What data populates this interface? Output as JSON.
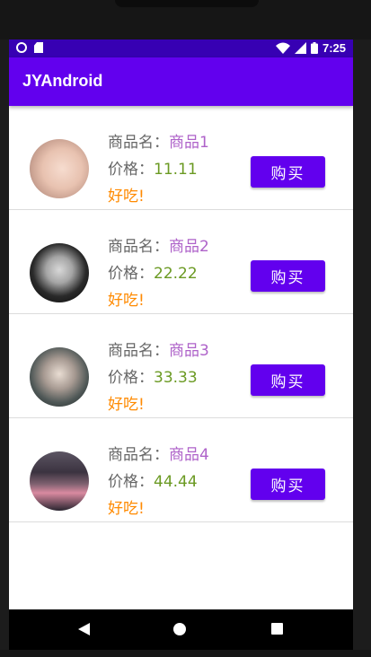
{
  "status_bar": {
    "time": "7:25",
    "left_icons": [
      "circle-indicator-icon",
      "sd-card-icon"
    ],
    "right_icons": [
      "wifi-icon",
      "signal-icon",
      "battery-icon"
    ],
    "background": "#3700b3"
  },
  "app_bar": {
    "title": "JYAndroid",
    "background": "#6200ee"
  },
  "products": [
    {
      "name_label": "商品名：",
      "name": "商品1",
      "price_label": "价格：",
      "price": "11.11",
      "note": "好吃!",
      "buy_label": "购买",
      "avatar": "anime-face-blush-avatar"
    },
    {
      "name_label": "商品名：",
      "name": "商品2",
      "price_label": "价格：",
      "price": "22.22",
      "note": "好吃!",
      "buy_label": "购买",
      "avatar": "dark-anime-face-avatar"
    },
    {
      "name_label": "商品名：",
      "name": "商品3",
      "price_label": "价格：",
      "price": "33.33",
      "note": "好吃!",
      "buy_label": "购买",
      "avatar": "sleeping-anime-avatar"
    },
    {
      "name_label": "商品名：",
      "name": "商品4",
      "price_label": "价格：",
      "price": "44.44",
      "note": "好吃!",
      "buy_label": "购买",
      "avatar": "sunset-clouds-avatar"
    }
  ],
  "colors": {
    "product_name": "#ae62c9",
    "price": "#6b9a23",
    "note": "#ff8a00",
    "button": "#6200ee"
  },
  "nav_bar": {
    "icons": [
      "back-icon",
      "home-icon",
      "recents-icon"
    ]
  }
}
